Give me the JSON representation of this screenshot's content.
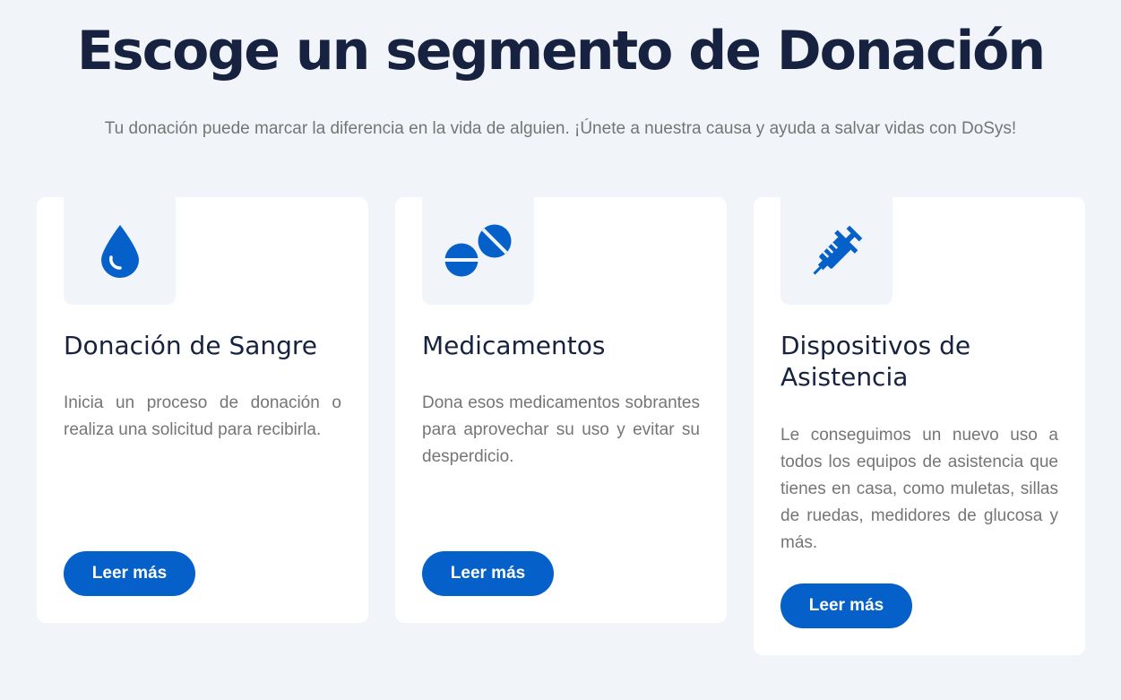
{
  "header": {
    "title": "Escoge un segmento de Donación",
    "subtitle": "Tu donación puede marcar la diferencia en la vida de alguien. ¡Únete a nuestra causa y ayuda a salvar vidas con DoSys!"
  },
  "theme": {
    "accent": "#0560c9",
    "background": "#f1f4f9",
    "card": "#ffffff",
    "heading": "#16223f",
    "body_text": "#757575"
  },
  "cards": [
    {
      "icon": "blood-drop-icon",
      "title": "Donación de Sangre",
      "text": "Inicia un proceso de donación o realiza una solicitud para recibirla.",
      "button": "Leer más"
    },
    {
      "icon": "pills-icon",
      "title": "Medicamentos",
      "text": "Dona esos medicamentos sobrantes para aprovechar su uso y evitar su desperdicio.",
      "button": "Leer más"
    },
    {
      "icon": "syringe-icon",
      "title": "Dispositivos de Asistencia",
      "text": "Le conseguimos un nuevo uso a todos los equipos de asistencia que tienes en casa, como muletas, sillas de ruedas, medidores de glucosa y más.",
      "button": "Leer más"
    }
  ]
}
